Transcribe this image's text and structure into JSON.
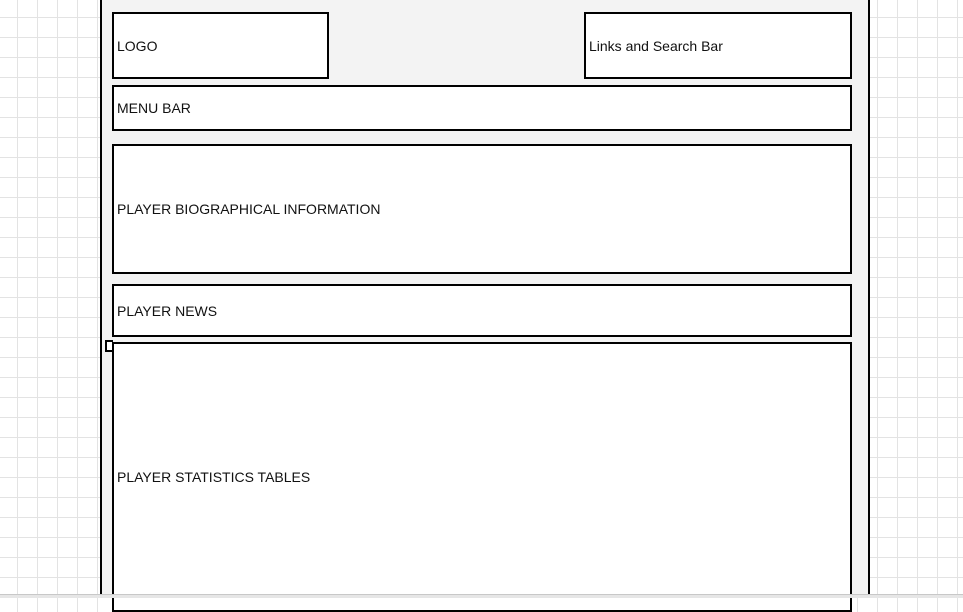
{
  "wireframe": {
    "logo_label": "LOGO",
    "links_label": "Links and Search Bar",
    "menu_label": "MENU BAR",
    "bio_label": "PLAYER BIOGRAPHICAL INFORMATION",
    "news_label": "PLAYER NEWS",
    "stats_label": "PLAYER STATISTICS TABLES"
  },
  "colors": {
    "canvas": "#ffffff",
    "grid": "#e3e3e3",
    "page_background": "#f3f3f3",
    "box_fill": "#ffffff",
    "outline": "#000000"
  }
}
